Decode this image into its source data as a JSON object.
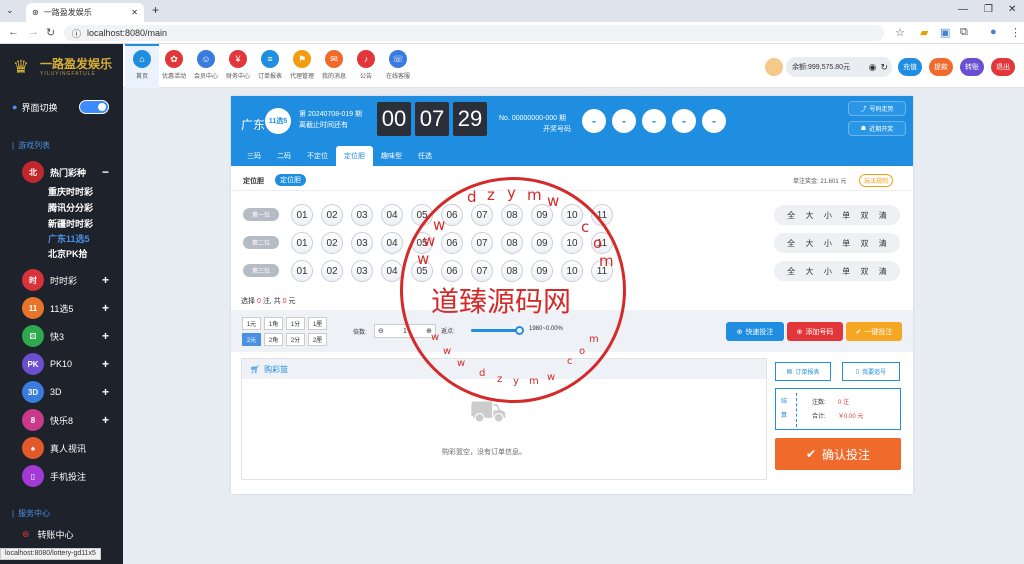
{
  "browser": {
    "tab_title": "一路盈发娱乐",
    "url": "localhost:8080/main",
    "status_url": "localhost:8080/lottery-gd11x5"
  },
  "sidebar": {
    "logo": "一路盈发娱乐",
    "logo_sub": "YILUYINGFATULE",
    "theme_toggle": "界面切换",
    "section_games": "游戏列表",
    "section_service": "服务中心",
    "hot": "热门彩种",
    "hot_items": [
      "重庆时时彩",
      "腾讯分分彩",
      "新疆时时彩",
      "广东11选5",
      "北京PK拾"
    ],
    "games": [
      "时时彩",
      "11选5",
      "快3",
      "PK10",
      "3D",
      "快乐8",
      "真人视讯",
      "手机投注"
    ],
    "transfer": "转账中心"
  },
  "topnav": {
    "items": [
      "首页",
      "优惠活动",
      "会员中心",
      "财务中心",
      "订单报表",
      "代理管理",
      "我的消息",
      "公告",
      "在线客服"
    ],
    "balance": "余额:999,575.80元",
    "recharge": "充值",
    "withdraw": "提款",
    "transfer": "转账",
    "logout": "退出"
  },
  "banner": {
    "region": "广东",
    "period": "第 20240708-019 期",
    "deadline": "离截止时间还有",
    "timer": [
      "00",
      "07",
      "29"
    ],
    "draw_no": "No. 00000000-000 期",
    "draw_label": "开奖号码",
    "draw_balls": [
      "-",
      "-",
      "-",
      "-",
      "-"
    ],
    "trend": "号码走势",
    "recent": "近期开奖"
  },
  "tabs": [
    "三码",
    "二码",
    "不定位",
    "定位胆",
    "趣味型",
    "任选"
  ],
  "subtab": {
    "label": "定位胆",
    "chip": "定位胆",
    "bonus": "单注奖金: 21.601 元",
    "rules": "玩法规则"
  },
  "rows": [
    {
      "label": "第一位"
    },
    {
      "label": "第二位"
    },
    {
      "label": "第三位"
    }
  ],
  "numbers": [
    "01",
    "02",
    "03",
    "04",
    "05",
    "06",
    "07",
    "08",
    "09",
    "10",
    "11"
  ],
  "quick": [
    "全",
    "大",
    "小",
    "单",
    "双",
    "清"
  ],
  "selection": {
    "prefix": "选择",
    "count": "0",
    "mid": "注, 共",
    "amount": "0",
    "suffix": "元"
  },
  "amounts": [
    "1元",
    "1角",
    "1分",
    "1厘",
    "2元",
    "2角",
    "2分",
    "2厘"
  ],
  "multiplier_label": "倍数:",
  "multiplier": "1",
  "rebate_label": "返点:",
  "rebate": "1980~0.00%",
  "actions": {
    "quick_bet": "快速投注",
    "add_number": "添加号码",
    "one_key": "一键投注"
  },
  "cart": {
    "title": "购彩篮",
    "empty": "购彩篮空，没有订单信息。",
    "order_report": "订单报表",
    "track": "我要追号",
    "side_label": "结算",
    "notes": "注数:",
    "notes_val": "0 注",
    "total": "合计:",
    "total_val": "￥0.00 元",
    "confirm": "确认投注"
  },
  "watermark": {
    "text": "道臻源码网",
    "letters": "dzymw.com"
  },
  "colors": {
    "primary": "#1f8de0",
    "sidebar": "#1e222b",
    "confirm": "#f06a2c",
    "red": "#e2363a"
  }
}
